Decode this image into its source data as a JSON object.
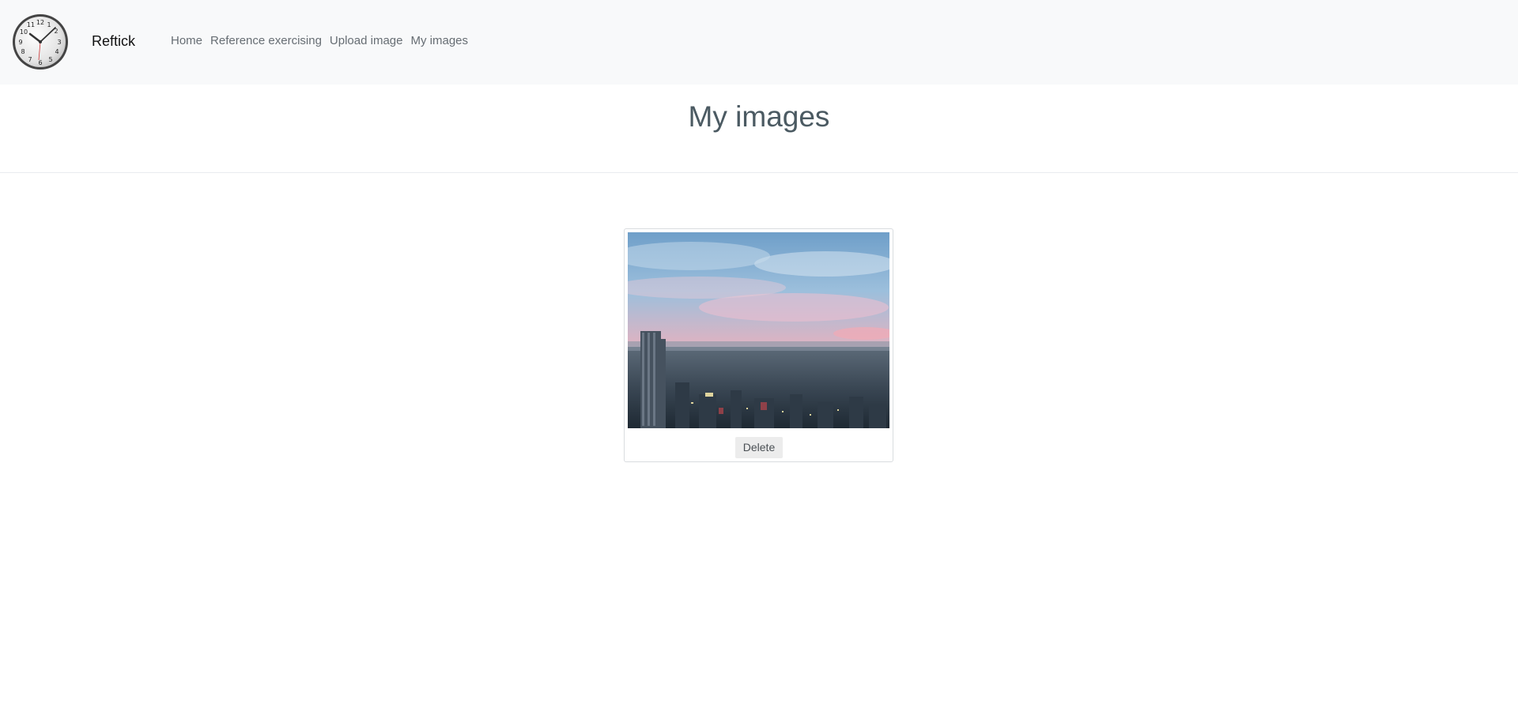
{
  "navbar": {
    "brand": "Reftick",
    "logo_icon": "clock-icon",
    "links": [
      {
        "label": "Home"
      },
      {
        "label": "Reference exercising"
      },
      {
        "label": "Upload image"
      },
      {
        "label": "My images"
      }
    ]
  },
  "main": {
    "title": "My images",
    "images": [
      {
        "delete_label": "Delete"
      }
    ]
  },
  "colors": {
    "navbar_bg": "#f8f9fa",
    "title": "#4b5a62",
    "nav_link": "#666d73",
    "button_bg": "#ececec"
  }
}
